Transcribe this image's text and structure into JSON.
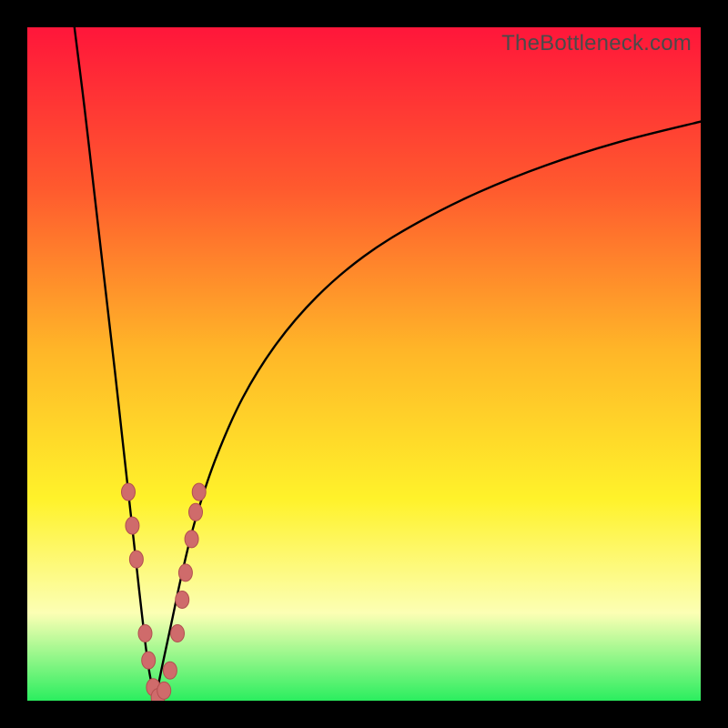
{
  "watermark": "TheBottleneck.com",
  "colors": {
    "frame": "#000000",
    "gradient_top": "#ff163a",
    "gradient_mid1": "#ff5a2e",
    "gradient_mid2": "#ffb628",
    "gradient_mid3": "#fff22a",
    "gradient_low": "#fcffb4",
    "gradient_bottom": "#2bee5f",
    "curve": "#000000",
    "marker_fill": "#cf6b6b",
    "marker_stroke": "#b24f4f"
  },
  "chart_data": {
    "type": "line",
    "title": "",
    "xlabel": "",
    "ylabel": "",
    "xlim": [
      0,
      100
    ],
    "ylim": [
      0,
      100
    ],
    "notch_x": 19,
    "series": [
      {
        "name": "left-branch",
        "x": [
          7,
          8.5,
          10,
          11.5,
          13,
          14,
          15,
          16,
          17,
          18,
          19
        ],
        "y": [
          100,
          88,
          75,
          62,
          49,
          40,
          31,
          22,
          13,
          5,
          0
        ]
      },
      {
        "name": "right-branch",
        "x": [
          19,
          20,
          21.5,
          23,
          25,
          28,
          32,
          37,
          43,
          50,
          58,
          67,
          77,
          88,
          100
        ],
        "y": [
          0,
          5,
          12,
          19,
          27,
          36,
          45,
          53,
          60,
          66,
          71,
          75.5,
          79.5,
          83,
          86
        ]
      }
    ],
    "markers": [
      {
        "x": 15.0,
        "y": 31
      },
      {
        "x": 15.6,
        "y": 26
      },
      {
        "x": 16.2,
        "y": 21
      },
      {
        "x": 17.5,
        "y": 10
      },
      {
        "x": 18.0,
        "y": 6
      },
      {
        "x": 18.7,
        "y": 2
      },
      {
        "x": 19.4,
        "y": 0.5
      },
      {
        "x": 20.3,
        "y": 1.5
      },
      {
        "x": 21.2,
        "y": 4.5
      },
      {
        "x": 22.3,
        "y": 10
      },
      {
        "x": 23.0,
        "y": 15
      },
      {
        "x": 23.5,
        "y": 19
      },
      {
        "x": 24.4,
        "y": 24
      },
      {
        "x": 25.0,
        "y": 28
      },
      {
        "x": 25.5,
        "y": 31
      }
    ]
  }
}
